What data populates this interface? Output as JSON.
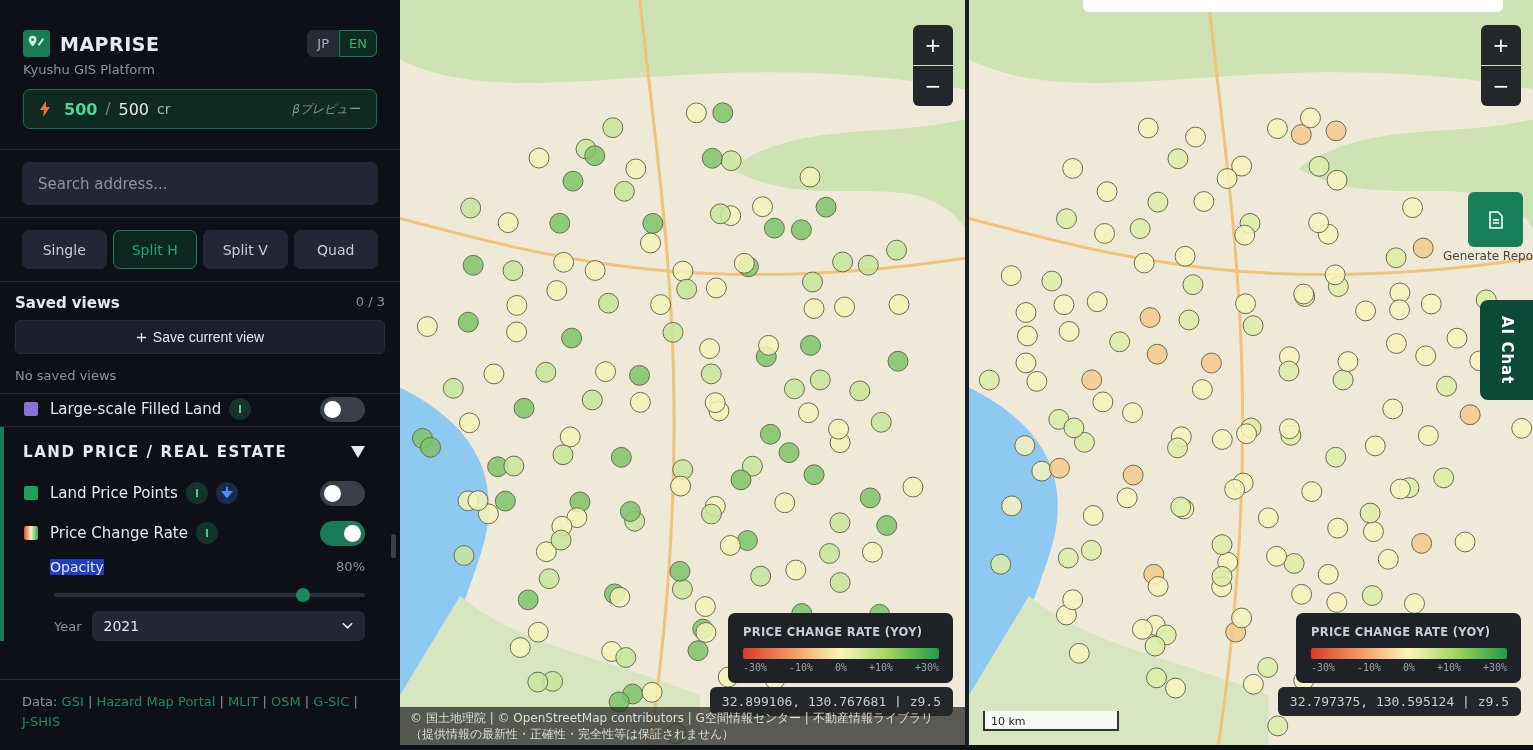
{
  "brand": {
    "title": "MAPRISE",
    "subtitle": "Kyushu GIS Platform"
  },
  "languages": [
    {
      "label": "JP",
      "selected": false
    },
    {
      "label": "EN",
      "selected": true
    }
  ],
  "credits": {
    "used": "500",
    "separator": "/",
    "total": "500",
    "unit": "cr",
    "badge": "βプレビュー"
  },
  "search": {
    "placeholder": "Search address..."
  },
  "layout_modes": [
    {
      "label": "Single",
      "selected": false
    },
    {
      "label": "Split H",
      "selected": true
    },
    {
      "label": "Split V",
      "selected": false
    },
    {
      "label": "Quad",
      "selected": false
    }
  ],
  "saved_views": {
    "title": "Saved views",
    "count": "0 / 3",
    "button": "Save current view",
    "empty": "No saved views"
  },
  "layers_above": [
    {
      "name": "Large-scale Filled Land",
      "kind": "solid",
      "color": "#8b6fd6",
      "on": false,
      "info": true,
      "download": false
    }
  ],
  "section": {
    "title": "LAND PRICE / REAL ESTATE",
    "expanded": true,
    "layers": [
      {
        "name": "Land Price Points",
        "kind": "solid",
        "color": "#22a055",
        "on": false,
        "info": true,
        "download": true
      },
      {
        "name": "Price Change Rate",
        "kind": "gradient",
        "on": true,
        "info": true,
        "download": false
      }
    ],
    "opacity": {
      "label": "Opacity",
      "highlighted": true,
      "reading": "80%",
      "level": 0.8
    },
    "year": {
      "label": "Year",
      "value": "2021"
    }
  },
  "footer": {
    "prefix": "Data:",
    "separator": "|",
    "links": [
      "GSI",
      "Hazard Map Portal",
      "MLIT",
      "OSM",
      "G-SIC",
      "J-SHIS"
    ]
  },
  "maps": [
    {
      "legend": {
        "title": "PRICE CHANGE RATE (YOY)",
        "ticks": [
          "-30%",
          "-10%",
          "0%",
          "+10%",
          "+30%"
        ]
      },
      "coords": "32.899106, 130.767681 | z9.5",
      "attribution": "© 国土地理院 | © OpenStreetMap contributors | G空間情報センター | 不動産情報ライブラリ（提供情報の最新性・正確性・完全性等は保証されません）"
    },
    {
      "legend": {
        "title": "PRICE CHANGE RATE (YOY)",
        "ticks": [
          "-30%",
          "-10%",
          "0%",
          "+10%",
          "+30%"
        ]
      },
      "coords": "32.797375, 130.595124 | z9.5",
      "scale": "10 km"
    }
  ],
  "zoom_controls": [
    "+",
    "−"
  ],
  "report_button": {
    "label": "Generate Repo"
  },
  "chat_tab": {
    "label": "AI Chat"
  }
}
